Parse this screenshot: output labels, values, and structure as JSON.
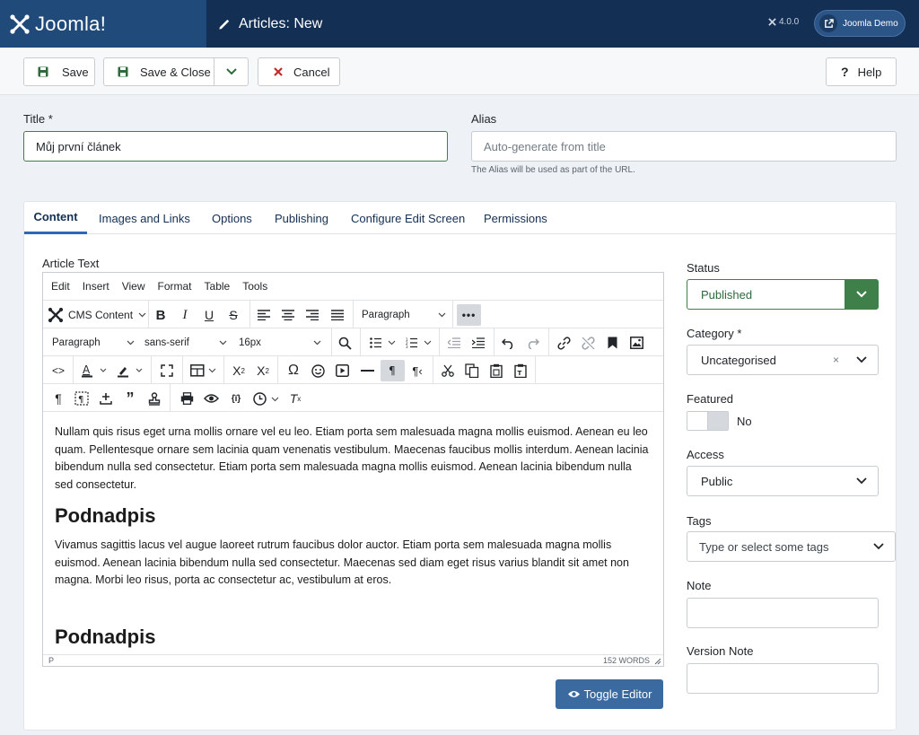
{
  "header": {
    "brand": "Joomla!",
    "page_title": "Articles: New",
    "version": "4.0.0",
    "user_button": "Joomla Demo"
  },
  "toolbar": {
    "save": "Save",
    "save_close": "Save & Close",
    "cancel": "Cancel",
    "help": "Help"
  },
  "form": {
    "title_label": "Title *",
    "title_value": "Můj první článek",
    "alias_label": "Alias",
    "alias_placeholder": "Auto-generate from title",
    "alias_hint": "The Alias will be used as part of the URL."
  },
  "tabs": [
    "Content",
    "Images and Links",
    "Options",
    "Publishing",
    "Configure Edit Screen",
    "Permissions"
  ],
  "editor": {
    "label": "Article Text",
    "menus": [
      "Edit",
      "Insert",
      "View",
      "Format",
      "Table",
      "Tools"
    ],
    "cms_content": "CMS Content",
    "block_format": "Paragraph",
    "font_format": "Paragraph",
    "font_family": "sans-serif",
    "font_size": "16px",
    "paragraphs": [
      "Nullam quis risus eget urna mollis ornare vel eu leo. Etiam porta sem malesuada magna mollis euismod. Aenean eu leo quam. Pellentesque ornare sem lacinia quam venenatis vestibulum. Maecenas faucibus mollis interdum. Aenean lacinia bibendum nulla sed consectetur. Etiam porta sem malesuada magna mollis euismod. Aenean lacinia bibendum nulla sed consectetur.",
      "Podnadpis",
      "Vivamus sagittis lacus vel augue laoreet rutrum faucibus dolor auctor. Etiam porta sem malesuada magna mollis euismod. Aenean lacinia bibendum nulla sed consectetur. Maecenas sed diam eget risus varius blandit sit amet non magna. Morbi leo risus, porta ac consectetur ac, vestibulum at eros.",
      "Podnadpis"
    ],
    "path": "P",
    "word_count": "152 WORDS",
    "toggle_button": "Toggle Editor"
  },
  "sidebar": {
    "status_label": "Status",
    "status_value": "Published",
    "category_label": "Category *",
    "category_value": "Uncategorised",
    "featured_label": "Featured",
    "featured_value": "No",
    "access_label": "Access",
    "access_value": "Public",
    "tags_label": "Tags",
    "tags_placeholder": "Type or select some tags",
    "note_label": "Note",
    "version_note_label": "Version Note"
  },
  "colors": {
    "header_bg": "#132f53",
    "brand_bg": "#1f4a7a",
    "published_green": "#3f7f4a",
    "accent_blue": "#2a69b8",
    "cancel_red": "#c52827"
  }
}
